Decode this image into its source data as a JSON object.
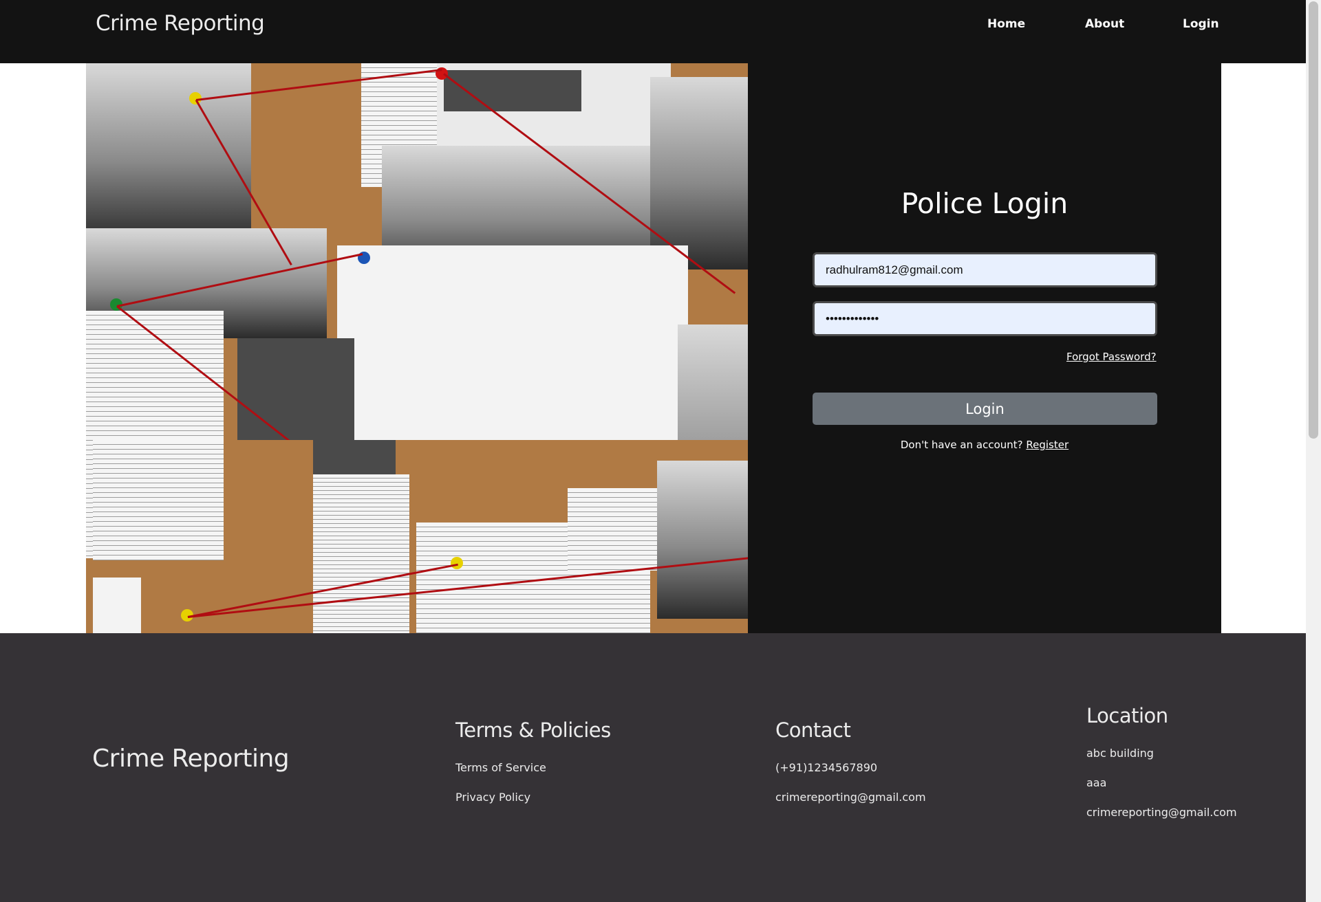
{
  "nav": {
    "brand": "Crime Reporting",
    "links": [
      "Home",
      "About",
      "Login"
    ]
  },
  "login": {
    "title": "Police Login",
    "email_value": "radhulram812@gmail.com",
    "password_value": "•••••••••••••",
    "forgot_label": "Forgot Password?",
    "submit_label": "Login",
    "register_prompt": "Don't have an account? ",
    "register_label": "Register"
  },
  "footer": {
    "brand": "Crime Reporting",
    "terms": {
      "heading": "Terms & Policies",
      "items": [
        "Terms of Service",
        "Privacy Policy"
      ]
    },
    "contact": {
      "heading": "Contact",
      "items": [
        "(+91)1234567890",
        "crimereporting@gmail.com"
      ]
    },
    "location": {
      "heading": "Location",
      "items": [
        "abc building",
        "aaa",
        "crimereporting@gmail.com"
      ]
    }
  },
  "colors": {
    "nav_bg": "#131313",
    "panel_bg": "#131313",
    "footer_bg": "#353236",
    "button_bg": "#6b7279",
    "input_bg": "#e8f0fe",
    "string_red": "#b00d12"
  }
}
